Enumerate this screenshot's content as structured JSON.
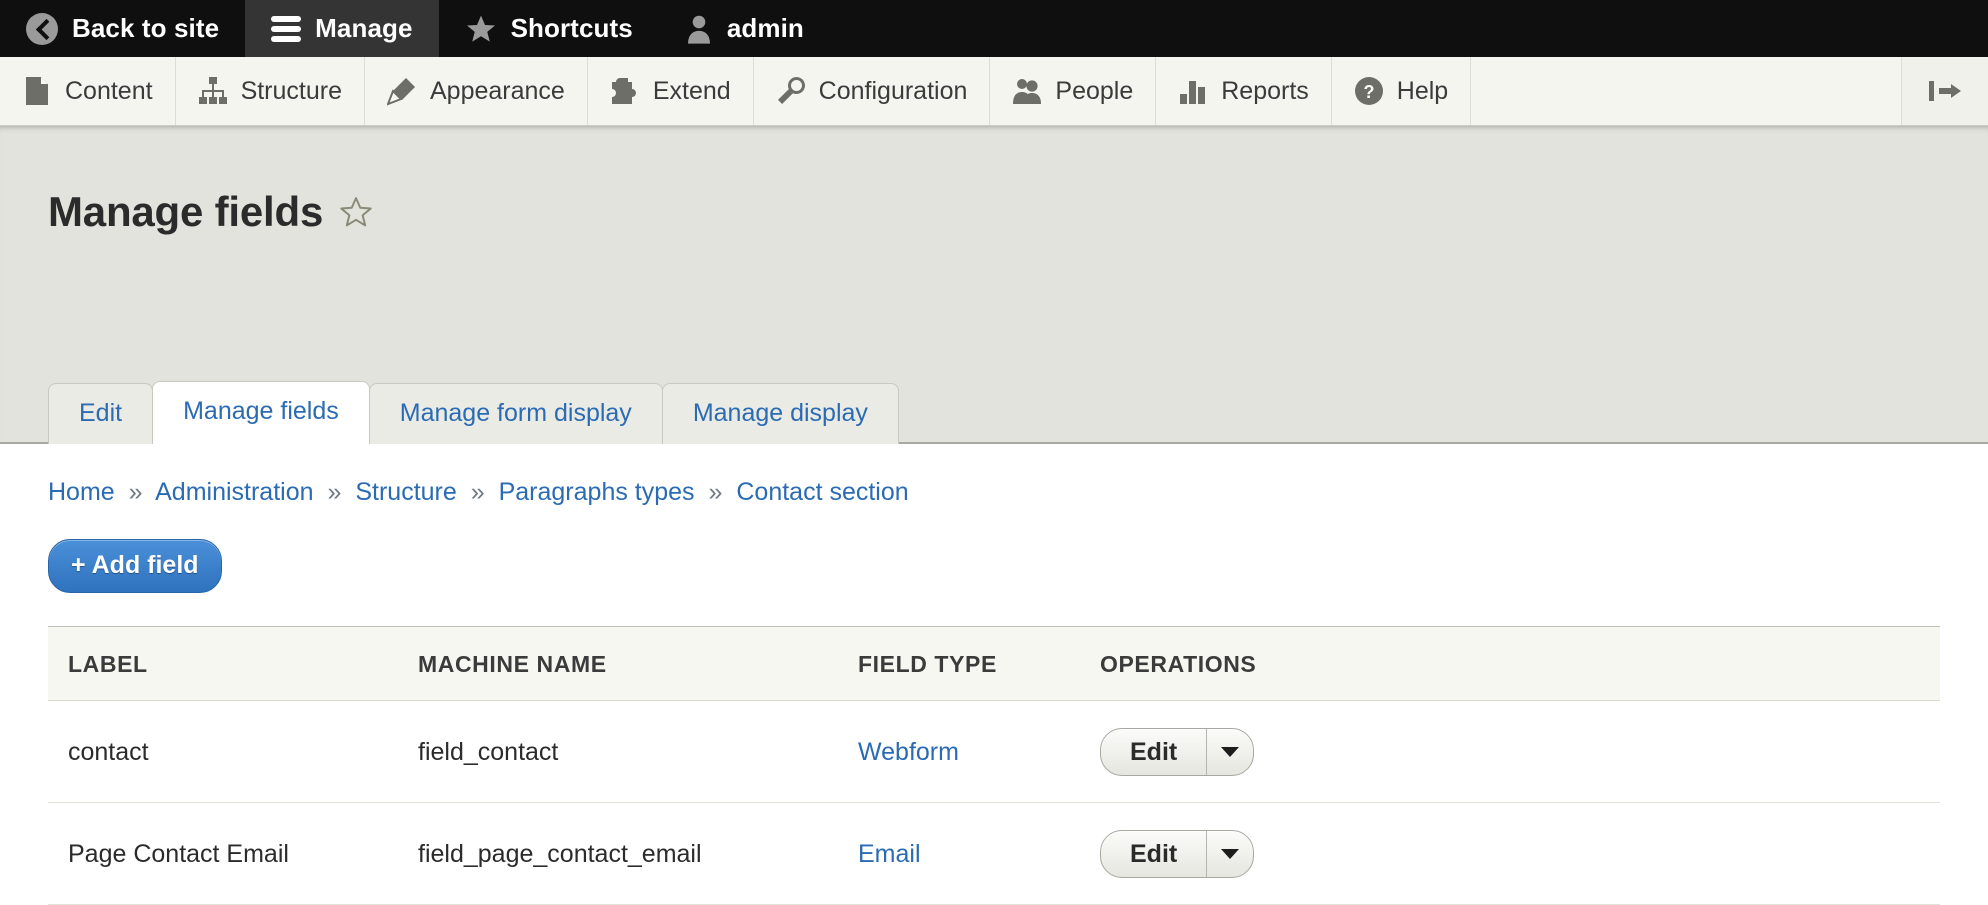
{
  "toolbar": {
    "items": [
      {
        "label": "Back to site",
        "icon": "back-circle-icon",
        "active": false
      },
      {
        "label": "Manage",
        "icon": "hamburger-icon",
        "active": true
      },
      {
        "label": "Shortcuts",
        "icon": "star-icon",
        "active": false
      },
      {
        "label": "admin",
        "icon": "user-icon",
        "active": false
      }
    ]
  },
  "admin_menu": {
    "items": [
      {
        "label": "Content",
        "icon": "document-icon"
      },
      {
        "label": "Structure",
        "icon": "sitemap-icon"
      },
      {
        "label": "Appearance",
        "icon": "paintbrush-icon"
      },
      {
        "label": "Extend",
        "icon": "puzzle-icon"
      },
      {
        "label": "Configuration",
        "icon": "wrench-icon"
      },
      {
        "label": "People",
        "icon": "people-icon"
      },
      {
        "label": "Reports",
        "icon": "bar-chart-icon"
      },
      {
        "label": "Help",
        "icon": "question-circle-icon"
      }
    ],
    "collapse_icon": "collapse-left-icon"
  },
  "page": {
    "title": "Manage fields",
    "favorite_icon": "star-outline-icon"
  },
  "tabs": [
    {
      "label": "Edit",
      "active": false
    },
    {
      "label": "Manage fields",
      "active": true
    },
    {
      "label": "Manage form display",
      "active": false
    },
    {
      "label": "Manage display",
      "active": false
    }
  ],
  "breadcrumb": {
    "separator": "»",
    "items": [
      "Home",
      "Administration",
      "Structure",
      "Paragraphs types",
      "Contact section"
    ]
  },
  "actions": {
    "add_field_label": "+ Add field"
  },
  "table": {
    "columns": [
      "LABEL",
      "MACHINE NAME",
      "FIELD TYPE",
      "OPERATIONS"
    ],
    "rows": [
      {
        "label": "contact",
        "machine_name": "field_contact",
        "field_type": "Webform",
        "operation": "Edit"
      },
      {
        "label": "Page Contact Email",
        "machine_name": "field_page_contact_email",
        "field_type": "Email",
        "operation": "Edit"
      }
    ]
  },
  "colors": {
    "toolbar_bg": "#0f0f0f",
    "toolbar_active_bg": "#343434",
    "menu_bg": "#f5f5f0",
    "header_band_bg": "#e3e3dd",
    "link_blue": "#2b6bb3",
    "button_blue": "#2f72bd",
    "text_dark": "#2b2b2b"
  }
}
